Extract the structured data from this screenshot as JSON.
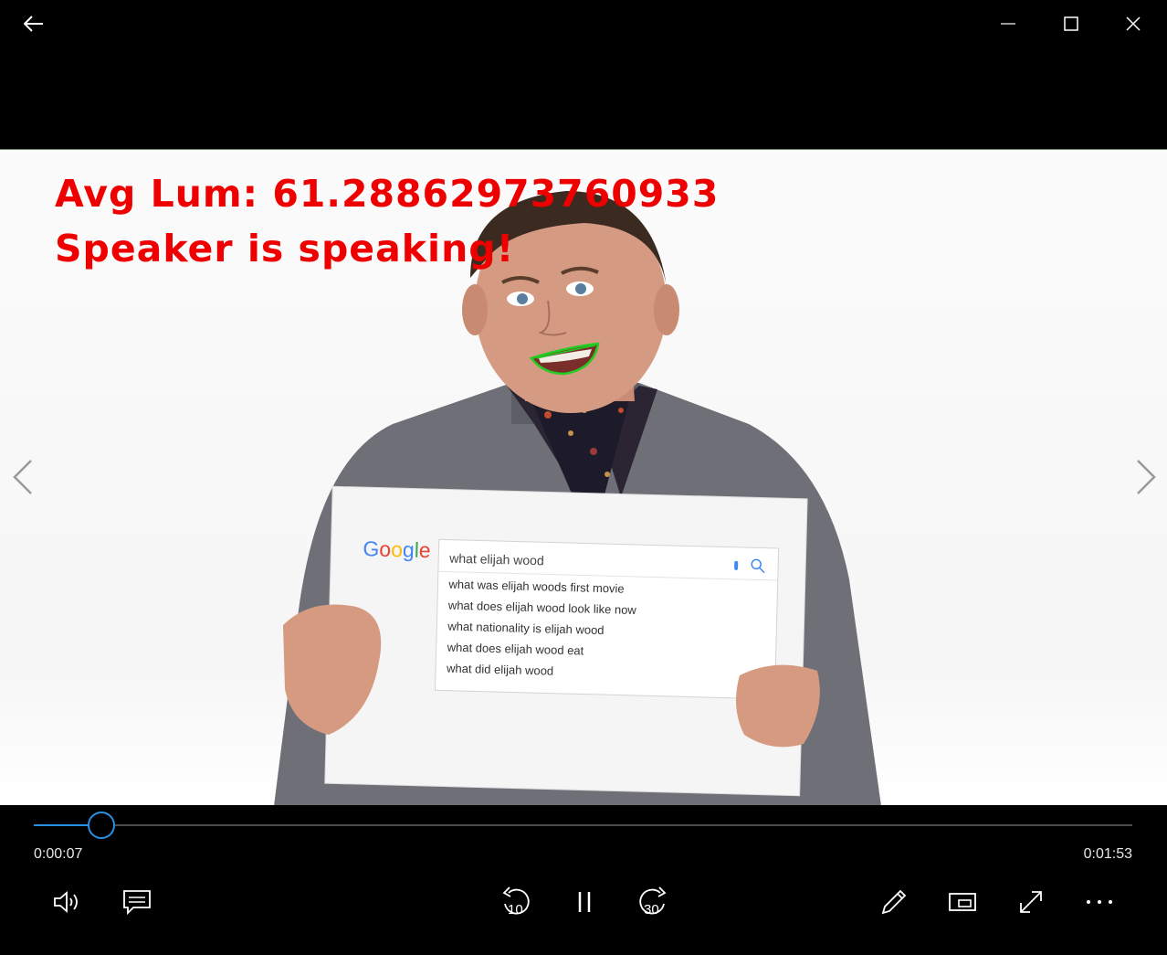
{
  "window": {
    "back_icon": "back-arrow-icon",
    "minimize_icon": "minimize-icon",
    "maximize_icon": "maximize-icon",
    "close_icon": "close-icon"
  },
  "video": {
    "overlay_line1": "Avg Lum: 61.28862973760933",
    "overlay_line2": "Speaker is speaking!",
    "overlay_color": "#ee0000",
    "lip_contour_color": "#22cc22",
    "sign": {
      "logo": "Google",
      "query": "what elijah wood",
      "suggestions": [
        "what was elijah woods first movie",
        "what does elijah wood look like now",
        "what nationality is elijah wood",
        "what does elijah wood eat",
        "what did elijah wood"
      ]
    }
  },
  "player": {
    "current_time": "0:00:07",
    "duration": "0:01:53",
    "progress_fraction": 0.0619,
    "accent": "#2b8fe0",
    "skip_back_seconds": "10",
    "skip_forward_seconds": "30",
    "controls": [
      "volume-icon",
      "captions-icon",
      "skip-back-10-icon",
      "pause-icon",
      "skip-forward-30-icon",
      "edit-pencil-icon",
      "mini-view-icon",
      "fullscreen-icon",
      "more-icon"
    ]
  }
}
